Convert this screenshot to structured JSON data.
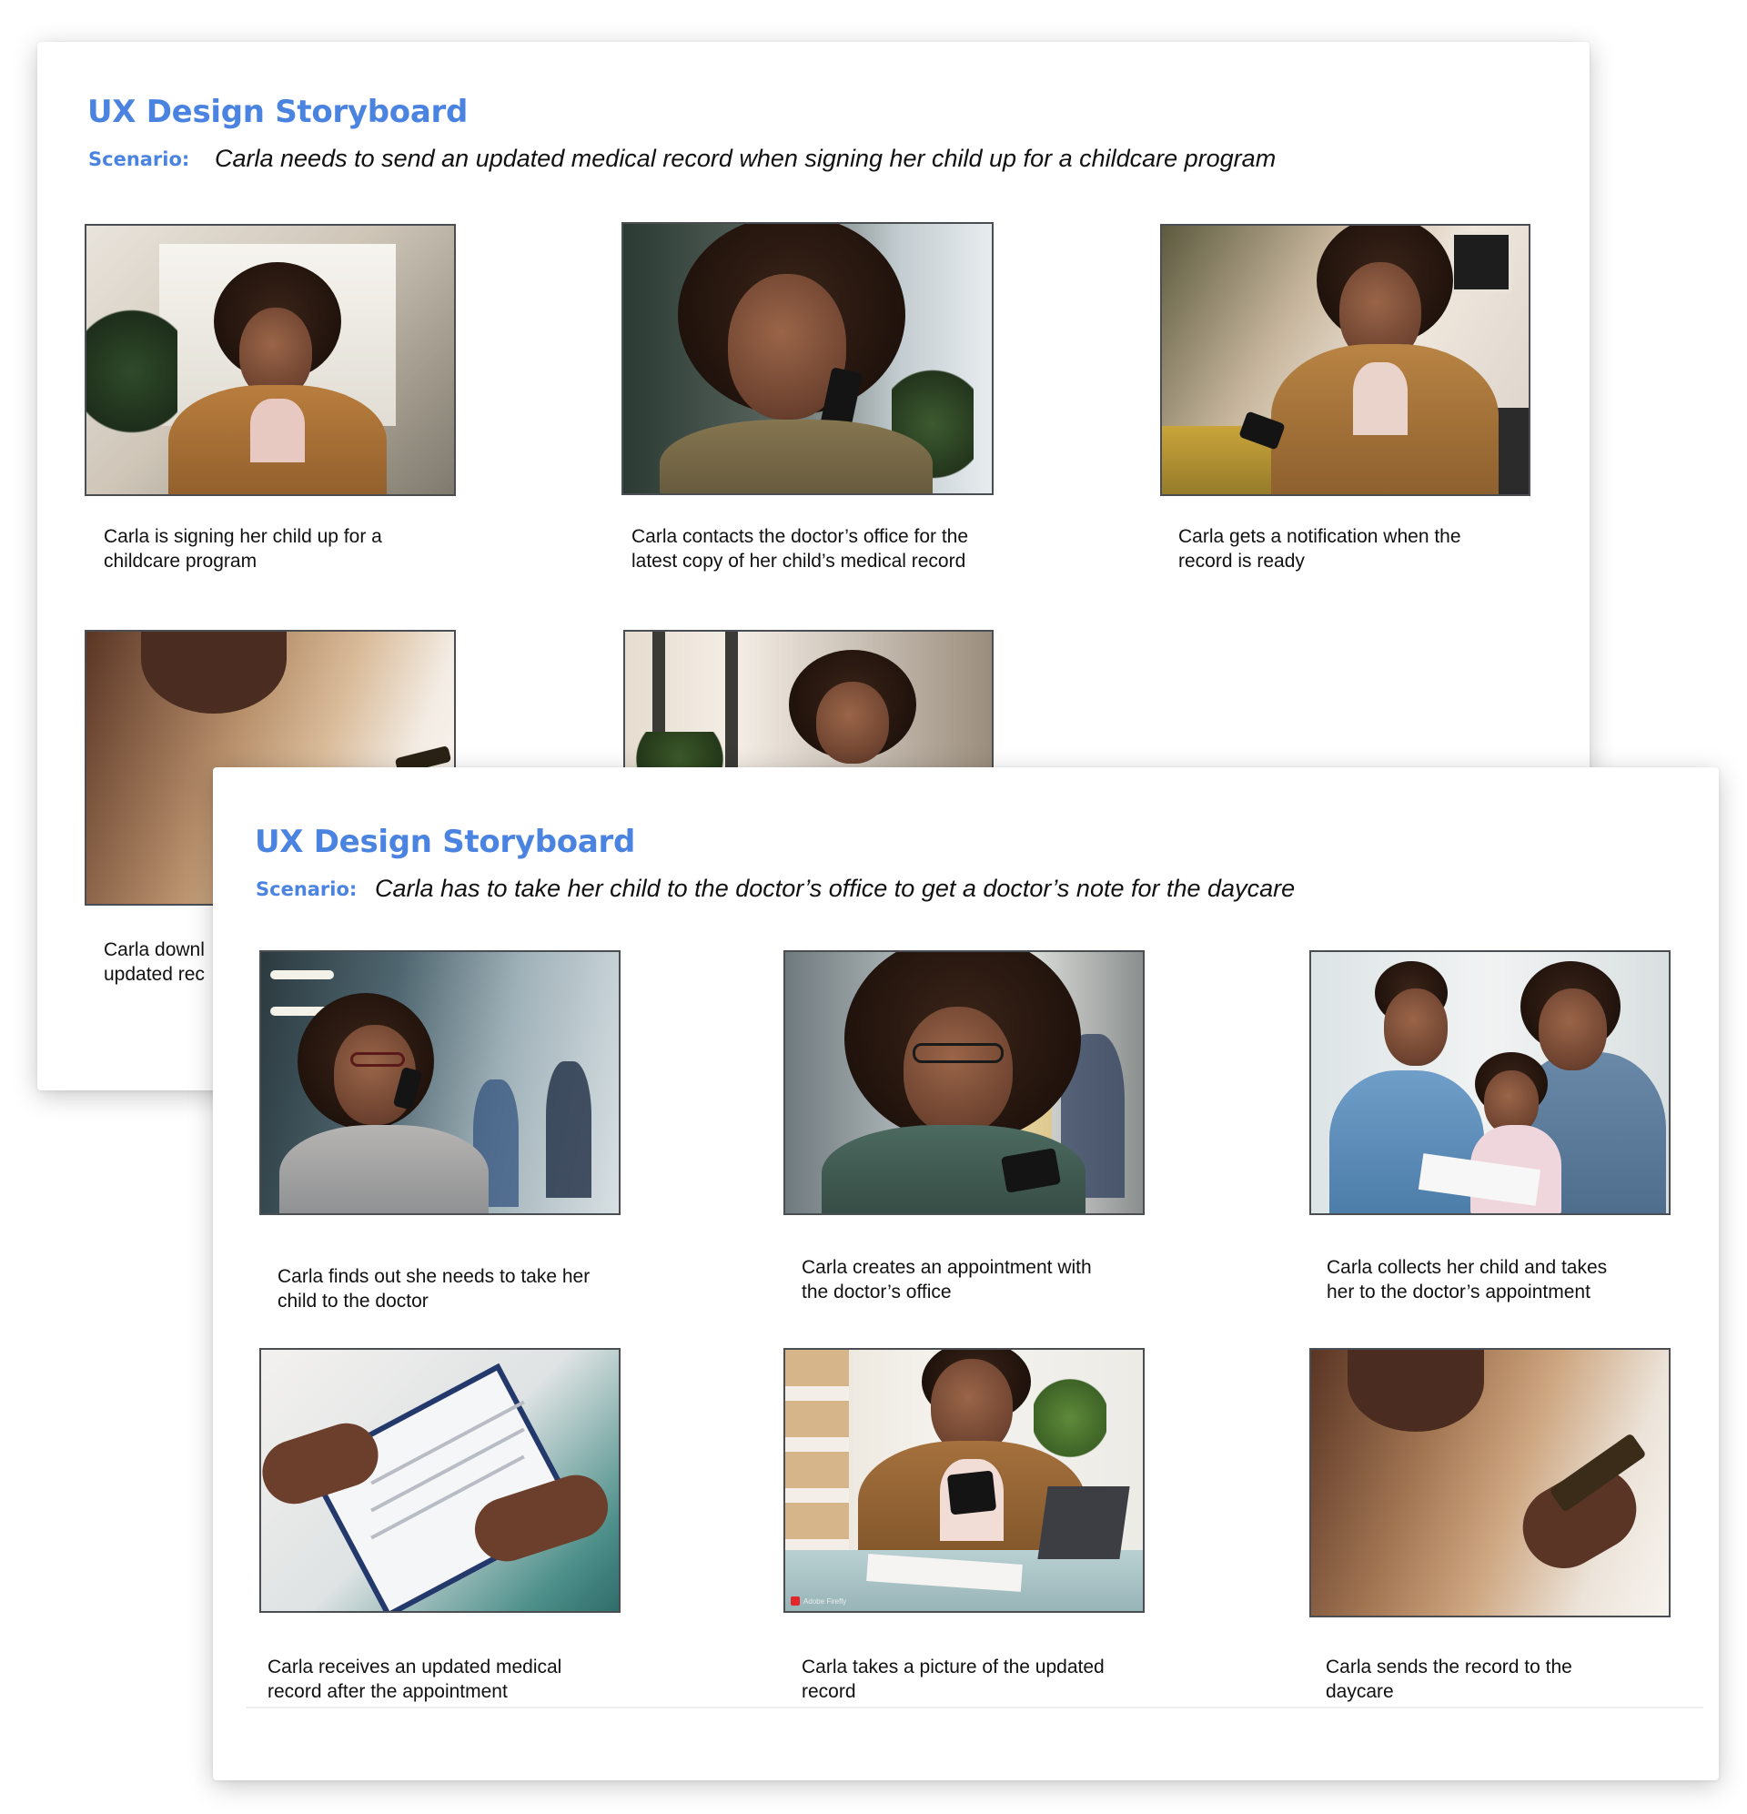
{
  "back_board": {
    "title": "UX Design Storyboard",
    "scenario_label": "Scenario:",
    "scenario_text": "Carla needs to send an updated medical record when signing her child up for a childcare program",
    "frames": [
      {
        "image": "woman-stressed-at-desk-photo",
        "caption_lines": [
          "Carla is signing her child up for a",
          "childcare program"
        ]
      },
      {
        "image": "woman-on-phone-call-worried-photo",
        "caption_lines": [
          "Carla contacts the doctor’s office for the",
          "latest copy of her child’s medical record"
        ]
      },
      {
        "image": "woman-smiling-at-phone-photo",
        "caption_lines": [
          "Carla gets a notification when the",
          "record is ready"
        ]
      },
      {
        "image": "woman-holding-phone-closeup-photo",
        "caption_lines": [
          "Carla downl",
          "updated rec"
        ]
      },
      {
        "image": "woman-looking-down-at-home-photo",
        "caption_lines": []
      }
    ]
  },
  "front_board": {
    "title": "UX Design Storyboard",
    "scenario_label": "Scenario:",
    "scenario_text": "Carla has to take her child to the doctor’s office to get a doctor’s note for the daycare",
    "frames": [
      {
        "image": "woman-on-phone-in-office-photo",
        "caption_lines": [
          "Carla finds out she needs to take her",
          "child to the doctor"
        ]
      },
      {
        "image": "woman-looking-at-phone-with-glasses-photo",
        "caption_lines": [
          "Carla creates an appointment with",
          "the doctor’s office"
        ]
      },
      {
        "image": "nurse-with-mother-and-child-photo",
        "caption_lines": [
          "Carla collects her child and takes",
          "her to the doctor’s appointment"
        ]
      },
      {
        "image": "clipboard-medical-form-handoff-photo",
        "caption_lines": [
          "Carla receives an updated medical",
          "record after the appointment"
        ]
      },
      {
        "image": "woman-photographing-document-photo",
        "caption_lines": [
          "Carla takes a picture of the updated",
          "record"
        ],
        "watermark": "Adobe Firefly"
      },
      {
        "image": "hands-using-phone-closeup-photo",
        "caption_lines": [
          "Carla sends the record to the",
          "daycare"
        ]
      }
    ]
  },
  "colors": {
    "title_blue": "#4a83e0",
    "caption_text": "#111111",
    "photo_border": "#4a4d52"
  }
}
